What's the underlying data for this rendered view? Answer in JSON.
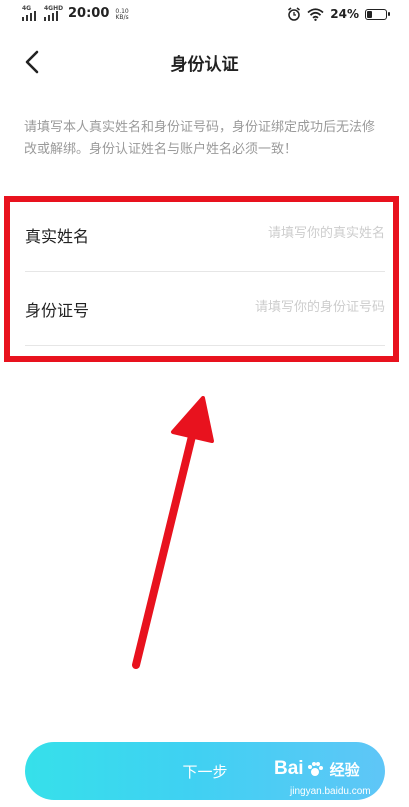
{
  "status_bar": {
    "network_1": "4G",
    "network_2": "4GHD",
    "time": "20:00",
    "speed_value": "0.10",
    "speed_unit": "KB/s",
    "battery_percent": "24%",
    "battery_level": 0.24
  },
  "header": {
    "title": "身份认证",
    "back_icon": "chevron-left-icon"
  },
  "notice": "请填写本人真实姓名和身份证号码，身份证绑定成功后无法修改或解绑。身份认证姓名与账户姓名必须一致！",
  "form": {
    "fields": [
      {
        "label": "真实姓名",
        "placeholder": "请填写你的真实姓名",
        "value": ""
      },
      {
        "label": "身份证号",
        "placeholder": "请填写你的身份证号码",
        "value": ""
      }
    ]
  },
  "footer": {
    "next_label": "下一步"
  },
  "watermark": {
    "brand": "Bai",
    "brand_tail": "经验",
    "url": "jingyan.baidu.com"
  },
  "colors": {
    "highlight": "#e8121e",
    "button_gradient_start": "#36e0ea",
    "button_gradient_end": "#5fc6f7"
  }
}
